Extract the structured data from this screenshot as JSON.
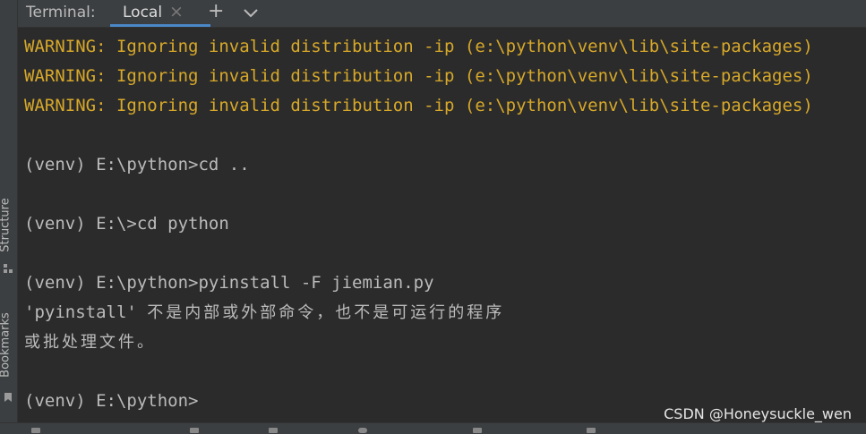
{
  "sidebar": {
    "structure_label": "Structure",
    "bookmarks_label": "Bookmarks"
  },
  "tabbar": {
    "title": "Terminal:",
    "active_tab": "Local",
    "close_glyph": "×",
    "add_glyph": "+",
    "dropdown_glyph": "⌵"
  },
  "terminal": {
    "lines": [
      "WARNING: Ignoring invalid distribution -ip (e:\\python\\venv\\lib\\site-packages)",
      "WARNING: Ignoring invalid distribution -ip (e:\\python\\venv\\lib\\site-packages)",
      "WARNING: Ignoring invalid distribution -ip (e:\\python\\venv\\lib\\site-packages)",
      "",
      "(venv) E:\\python>cd ..",
      "",
      "(venv) E:\\>cd python",
      "",
      "(venv) E:\\python>pyinstall -F jiemian.py",
      "'pyinstall'",
      "或批处理文件。",
      "",
      "(venv) E:\\python>"
    ],
    "error_cjk": "不是内部或外部命令，也不是可运行的程序"
  },
  "watermark": "CSDN @Honeysuckle_wen",
  "colors": {
    "background": "#2b2b2b",
    "warning": "#d7a829",
    "text": "#bbbbbb",
    "tab_underline": "#4a88c7"
  }
}
